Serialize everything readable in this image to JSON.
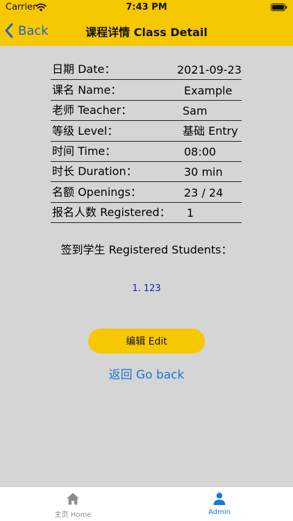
{
  "status_bar": {
    "carrier": "Carrier",
    "time": "7:43 PM"
  },
  "nav": {
    "back_label": "Back",
    "title": "课程详情 Class Detail"
  },
  "details": [
    {
      "label": "日期 Date：",
      "value": "2021-09-23"
    },
    {
      "label": "课名 Name：",
      "value": "Example"
    },
    {
      "label": "老师 Teacher：",
      "value": "Sam"
    },
    {
      "label": "等级 Level：",
      "value": "基础 Entry"
    },
    {
      "label": "时间 Time：",
      "value": "08:00"
    },
    {
      "label": "时长 Duration：",
      "value": "30 min"
    },
    {
      "label": "名额 Openings：",
      "value": "23 / 24"
    },
    {
      "label": "报名人数 Registered：",
      "value": "1"
    }
  ],
  "students": {
    "heading": "签到学生 Registered Students：",
    "items": [
      "1. 123"
    ]
  },
  "actions": {
    "edit_label": "编辑 Edit",
    "go_back_label": "返回 Go back"
  },
  "tab_bar": {
    "tabs": [
      {
        "label": "主页 Home",
        "icon": "house-icon",
        "active": false
      },
      {
        "label": "Admin",
        "icon": "person-icon",
        "active": true
      }
    ]
  },
  "colors": {
    "brand_yellow": "#f6c800",
    "link_blue": "#1d74d9",
    "tab_active": "#1d74d9",
    "tab_inactive": "#8e8e8e",
    "background": "#d5d5d5"
  }
}
